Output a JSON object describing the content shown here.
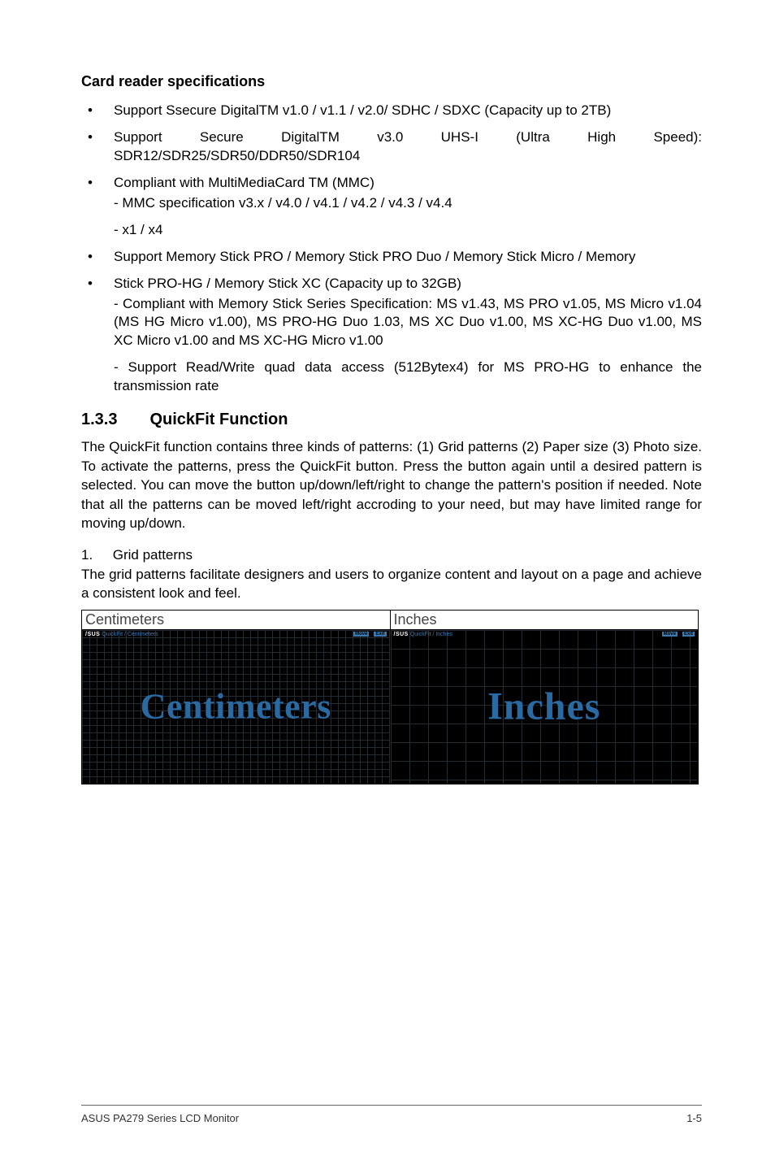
{
  "cardreader": {
    "heading": "Card reader specifications",
    "items": [
      {
        "text": "Support Ssecure DigitalTM v1.0 / v1.1 / v2.0/ SDHC / SDXC (Capacity up to 2TB)"
      },
      {
        "text": "Support Secure DigitalTM v3.0 UHS-I (Ultra High Speed): SDR12/SDR25/SDR50/DDR50/SDR104"
      },
      {
        "text": "Compliant with MultiMediaCard TM (MMC)",
        "subs": [
          "- MMC specification v3.x / v4.0 / v4.1 / v4.2 / v4.3 / v4.4",
          "- x1 / x4"
        ]
      },
      {
        "text": "Support Memory Stick PRO / Memory Stick PRO Duo / Memory Stick Micro / Memory"
      },
      {
        "text": "Stick PRO-HG / Memory Stick XC (Capacity up to 32GB)",
        "subs": [
          "- Compliant with Memory Stick Series Specification: MS v1.43, MS PRO v1.05, MS Micro v1.04 (MS HG Micro v1.00), MS PRO-HG Duo 1.03, MS XC Duo v1.00, MS XC-HG Duo v1.00, MS XC Micro v1.00 and MS XC-HG Micro v1.00",
          "- Support Read/Write quad data access (512Bytex4) for MS PRO-HG to enhance the transmission rate"
        ]
      }
    ]
  },
  "section": {
    "num": "1.3.3",
    "title": "QuickFit Function",
    "para": "The QuickFit function contains three kinds of patterns: (1) Grid patterns (2) Paper size (3) Photo size. To activate the patterns, press the QuickFit button. Press the button again until a desired pattern is selected. You can move the button up/down/left/right to change the pattern's position if needed. Note that all the patterns can be moved left/right accroding to your need, but may have limited range for moving up/down.",
    "item1_num": "1.",
    "item1_title": "Grid patterns",
    "item1_body": "The grid patterns facilitate designers and users to organize content and layout on a page and achieve a consistent look and feel."
  },
  "table": {
    "col1_header": "Centimeters",
    "col2_header": "Inches",
    "cm_label": "Centimeters",
    "in_label": "Inches",
    "brand": "/SUS",
    "cm_sub": "QuickFit / Centimeters",
    "in_sub": "QuickFit / Inches",
    "move": "Move",
    "exit": "Exit"
  },
  "footer": {
    "left": "ASUS PA279 Series LCD Monitor",
    "right": "1-5"
  }
}
